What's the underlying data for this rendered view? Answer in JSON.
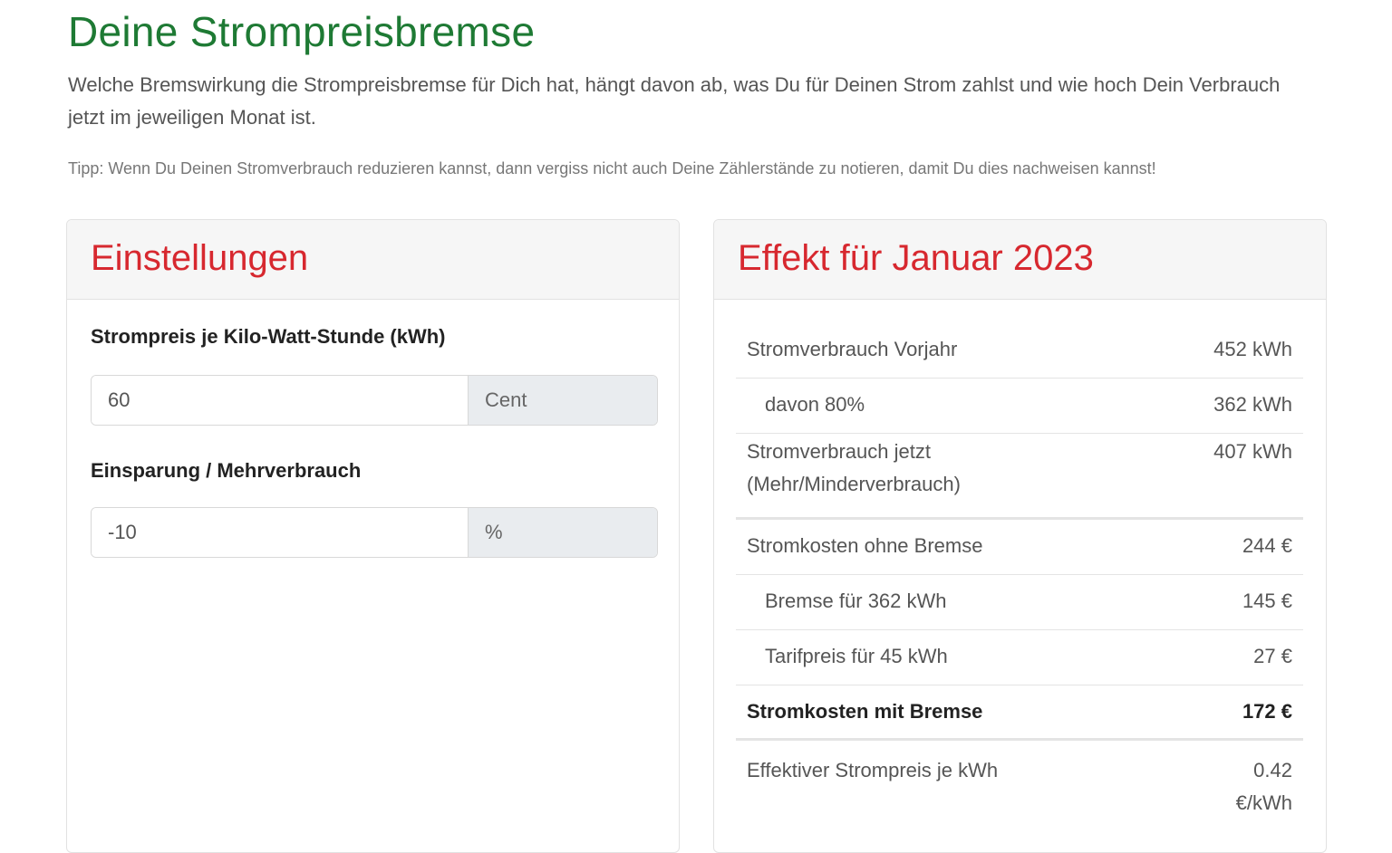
{
  "page": {
    "title": "Deine Strompreisbremse",
    "intro": "Welche Bremswirkung die Strompreisbremse für Dich hat, hängt davon ab, was Du für Deinen Strom zahlst und wie hoch Dein Verbrauch jetzt im jeweiligen Monat ist.",
    "tip": "Tipp: Wenn Du Deinen Stromverbrauch reduzieren kannst, dann vergiss nicht auch Deine Zählerstände zu notieren, damit Du dies nachweisen kannst!"
  },
  "settings": {
    "header": "Einstellungen",
    "price_label": "Strompreis je Kilo-Watt-Stunde (kWh)",
    "price_value": "60",
    "price_unit": "Cent",
    "saving_label": "Einsparung / Mehrverbrauch",
    "saving_value": "-10",
    "saving_unit": "%"
  },
  "effect": {
    "header": "Effekt für Januar 2023",
    "rows": [
      {
        "label": "Stromverbrauch Vorjahr",
        "value": "452 kWh"
      },
      {
        "label": "davon 80%",
        "value": "362 kWh"
      },
      {
        "label": "Stromverbrauch jetzt (Mehr/Minderverbrauch)",
        "value": "407 kWh"
      },
      {
        "label": "Stromkosten ohne Bremse",
        "value": "244 €"
      },
      {
        "label": "Bremse für 362 kWh",
        "value": "145 €"
      },
      {
        "label": "Tarifpreis für 45 kWh",
        "value": "27 €"
      },
      {
        "label": "Stromkosten mit Bremse",
        "value": "172 €"
      },
      {
        "label": "Effektiver Strompreis je kWh",
        "value": "0.42 €/kWh"
      }
    ]
  },
  "colors": {
    "title_green": "#1e7a34",
    "header_red": "#d7282f"
  }
}
